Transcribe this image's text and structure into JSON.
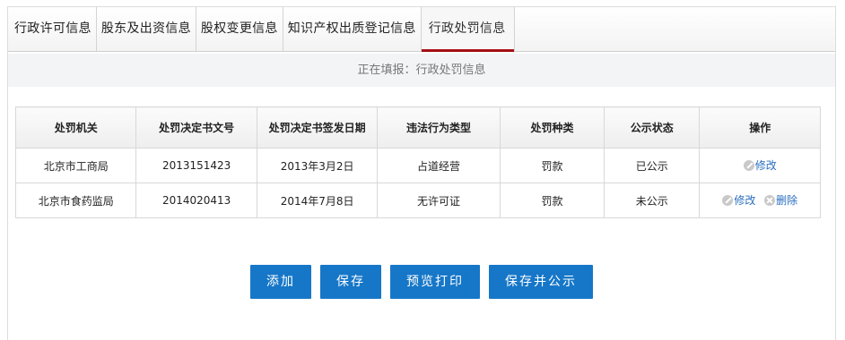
{
  "tabs": [
    {
      "label": "行政许可信息"
    },
    {
      "label": "股东及出资信息"
    },
    {
      "label": "股权变更信息"
    },
    {
      "label": "知识产权出质登记信息"
    },
    {
      "label": "行政处罚信息"
    }
  ],
  "active_tab_index": 4,
  "filling_status": "正在填报：行政处罚信息",
  "table": {
    "headers": [
      "处罚机关",
      "处罚决定书文号",
      "处罚决定书签发日期",
      "违法行为类型",
      "处罚种类",
      "公示状态",
      "操作"
    ],
    "rows": [
      {
        "authority": "北京市工商局",
        "doc_number": "2013151423",
        "issue_date": "2013年3月2日",
        "violation_type": "占道经营",
        "penalty_type": "罚款",
        "status": "已公示",
        "edit_label": "修改"
      },
      {
        "authority": "北京市食药监局",
        "doc_number": "2014020413",
        "issue_date": "2014年7月8日",
        "violation_type": "无许可证",
        "penalty_type": "罚款",
        "status": "未公示",
        "edit_label": "修改",
        "delete_label": "删除"
      }
    ]
  },
  "buttons": {
    "add": "添加",
    "save": "保存",
    "preview_print": "预览打印",
    "save_publish": "保存并公示"
  },
  "icons": {
    "edit": "edit-icon",
    "delete": "delete-icon"
  },
  "colors": {
    "accent": "#a50f14",
    "primary_button": "#1677c8",
    "link": "#2a6fc0"
  }
}
